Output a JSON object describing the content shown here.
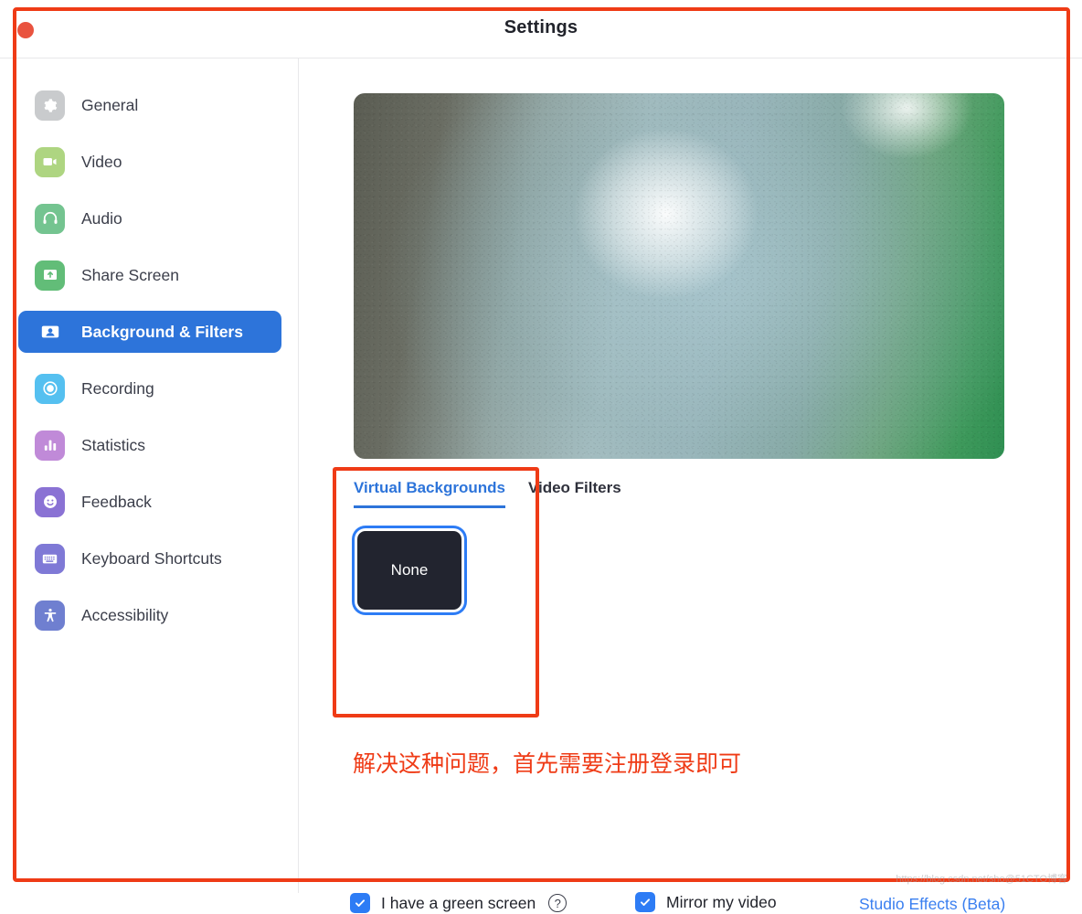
{
  "window": {
    "title": "Settings",
    "close_button": "close"
  },
  "sidebar": {
    "items": [
      {
        "label": "General",
        "icon": "gear-icon",
        "color": "#c9cbcd",
        "selected": false
      },
      {
        "label": "Video",
        "icon": "camera-icon",
        "color": "#aed581",
        "selected": false
      },
      {
        "label": "Audio",
        "icon": "headphones-icon",
        "color": "#74c490",
        "selected": false
      },
      {
        "label": "Share Screen",
        "icon": "upload-icon",
        "color": "#62bd78",
        "selected": false
      },
      {
        "label": "Background & Filters",
        "icon": "person-card-icon",
        "color": "#2d74da",
        "selected": true
      },
      {
        "label": "Recording",
        "icon": "record-icon",
        "color": "#55c0f0",
        "selected": false
      },
      {
        "label": "Statistics",
        "icon": "bars-icon",
        "color": "#c08ad8",
        "selected": false
      },
      {
        "label": "Feedback",
        "icon": "smiley-icon",
        "color": "#8a72d4",
        "selected": false
      },
      {
        "label": "Keyboard Shortcuts",
        "icon": "keyboard-icon",
        "color": "#7f79d6",
        "selected": false
      },
      {
        "label": "Accessibility",
        "icon": "accessibility-icon",
        "color": "#6f7fd0",
        "selected": false
      }
    ]
  },
  "main": {
    "tabs": [
      {
        "label": "Virtual Backgrounds",
        "active": true
      },
      {
        "label": "Video Filters",
        "active": false
      }
    ],
    "backgrounds": [
      {
        "label": "None",
        "selected": true
      }
    ],
    "controls": {
      "green_screen_label": "I have a green screen",
      "green_screen_checked": true,
      "help_glyph": "?",
      "mirror_label": "Mirror my video",
      "mirror_checked": true,
      "studio_effects_label": "Studio Effects (Beta)"
    }
  },
  "annotations": {
    "note_text": "解决这种问题，首先需要注册登录即可",
    "accent_color": "#ef3b16"
  },
  "watermark": {
    "text": "https://blog.csdn.net/sho@51CTO博客"
  }
}
